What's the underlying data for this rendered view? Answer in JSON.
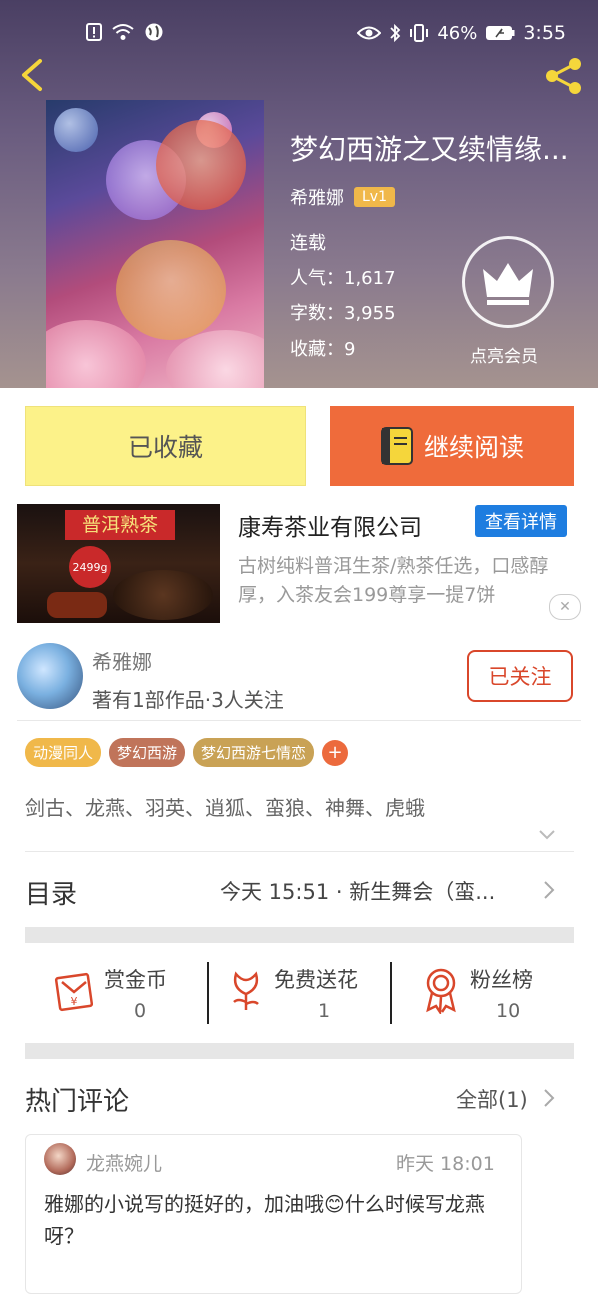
{
  "status_bar": {
    "battery": "46%",
    "time": "3:55"
  },
  "book": {
    "title": "梦幻西游之又续情缘...",
    "author": "希雅娜",
    "level_badge": "Lv1",
    "status": "连载",
    "popularity": "人气：1,617",
    "word_count": "字数：3,955",
    "favorites": "收藏：9",
    "vip_label": "点亮会员"
  },
  "actions": {
    "collect_label": "已收藏",
    "read_label": "继续阅读"
  },
  "ad": {
    "image_text": "普洱熟茶",
    "price_text": "2499g",
    "company": "康寿茶业有限公司",
    "detail_button": "查看详情",
    "description": "古树纯料普洱生茶/熟茶任选，口感醇厚，入茶友会199尊享一提7饼",
    "close": "✕"
  },
  "author_card": {
    "name": "希雅娜",
    "info": "著有1部作品·3人关注",
    "follow_label": "已关注"
  },
  "tags": {
    "items": [
      "动漫同人",
      "梦幻西游",
      "梦幻西游七情恋"
    ],
    "colors": [
      "#f0b84a",
      "#c0745a",
      "#c9a255"
    ],
    "plus": "+"
  },
  "characters": "剑古、龙燕、羽英、逍狐、蛮狼、神舞、虎蛾",
  "toc": {
    "label": "目录",
    "latest": "今天 15:51 · 新生舞会（蛮..."
  },
  "stats": {
    "reward": {
      "label": "赏金币",
      "value": "0",
      "icon": "red-envelope-icon"
    },
    "flower": {
      "label": "免费送花",
      "value": "1",
      "icon": "flower-icon"
    },
    "fans": {
      "label": "粉丝榜",
      "value": "10",
      "icon": "medal-icon"
    }
  },
  "comments": {
    "title": "热门评论",
    "all_label": "全部(1)",
    "items": [
      {
        "user": "龙燕婉儿",
        "time": "昨天 18:01",
        "text_a": "雅娜的小说写的挺好的，加油哦",
        "emoji": "😊",
        "text_b": "什么时候写龙燕呀？"
      }
    ]
  },
  "colors": {
    "accent_orange": "#ef6b3b",
    "collect_yellow": "#fcf289",
    "follow_red": "#d9472b",
    "detail_blue": "#1e7de0",
    "icon_yellow": "#f5d63b"
  }
}
